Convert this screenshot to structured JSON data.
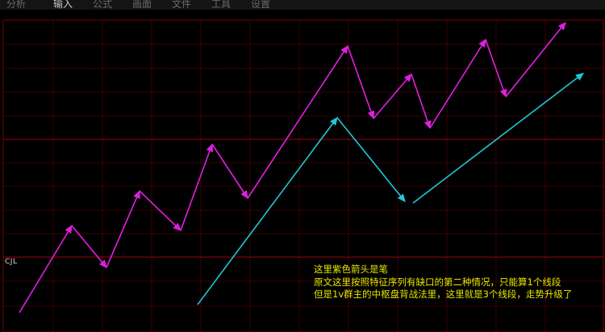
{
  "menu": {
    "tabs": [
      "分析",
      "输入",
      "公式",
      "画面",
      "文件",
      "工具",
      "设置"
    ],
    "active_index": 1
  },
  "chart": {
    "indicator_label": "CJL",
    "annotation_lines": [
      "这里紫色箭头是笔",
      "原文这里按照特征序列有缺口的第二种情况，只能算1个线段",
      "但是1v群主的中枢盘背战法里，这里就是3个线段，走势升级了"
    ],
    "colors": {
      "background": "#000000",
      "grid": "#7a0000",
      "grid_strong": "#a00010",
      "stroke_arrows": "#e020e0",
      "segment_arrows": "#20c8d8",
      "annotation_text": "#e6e600"
    }
  }
}
